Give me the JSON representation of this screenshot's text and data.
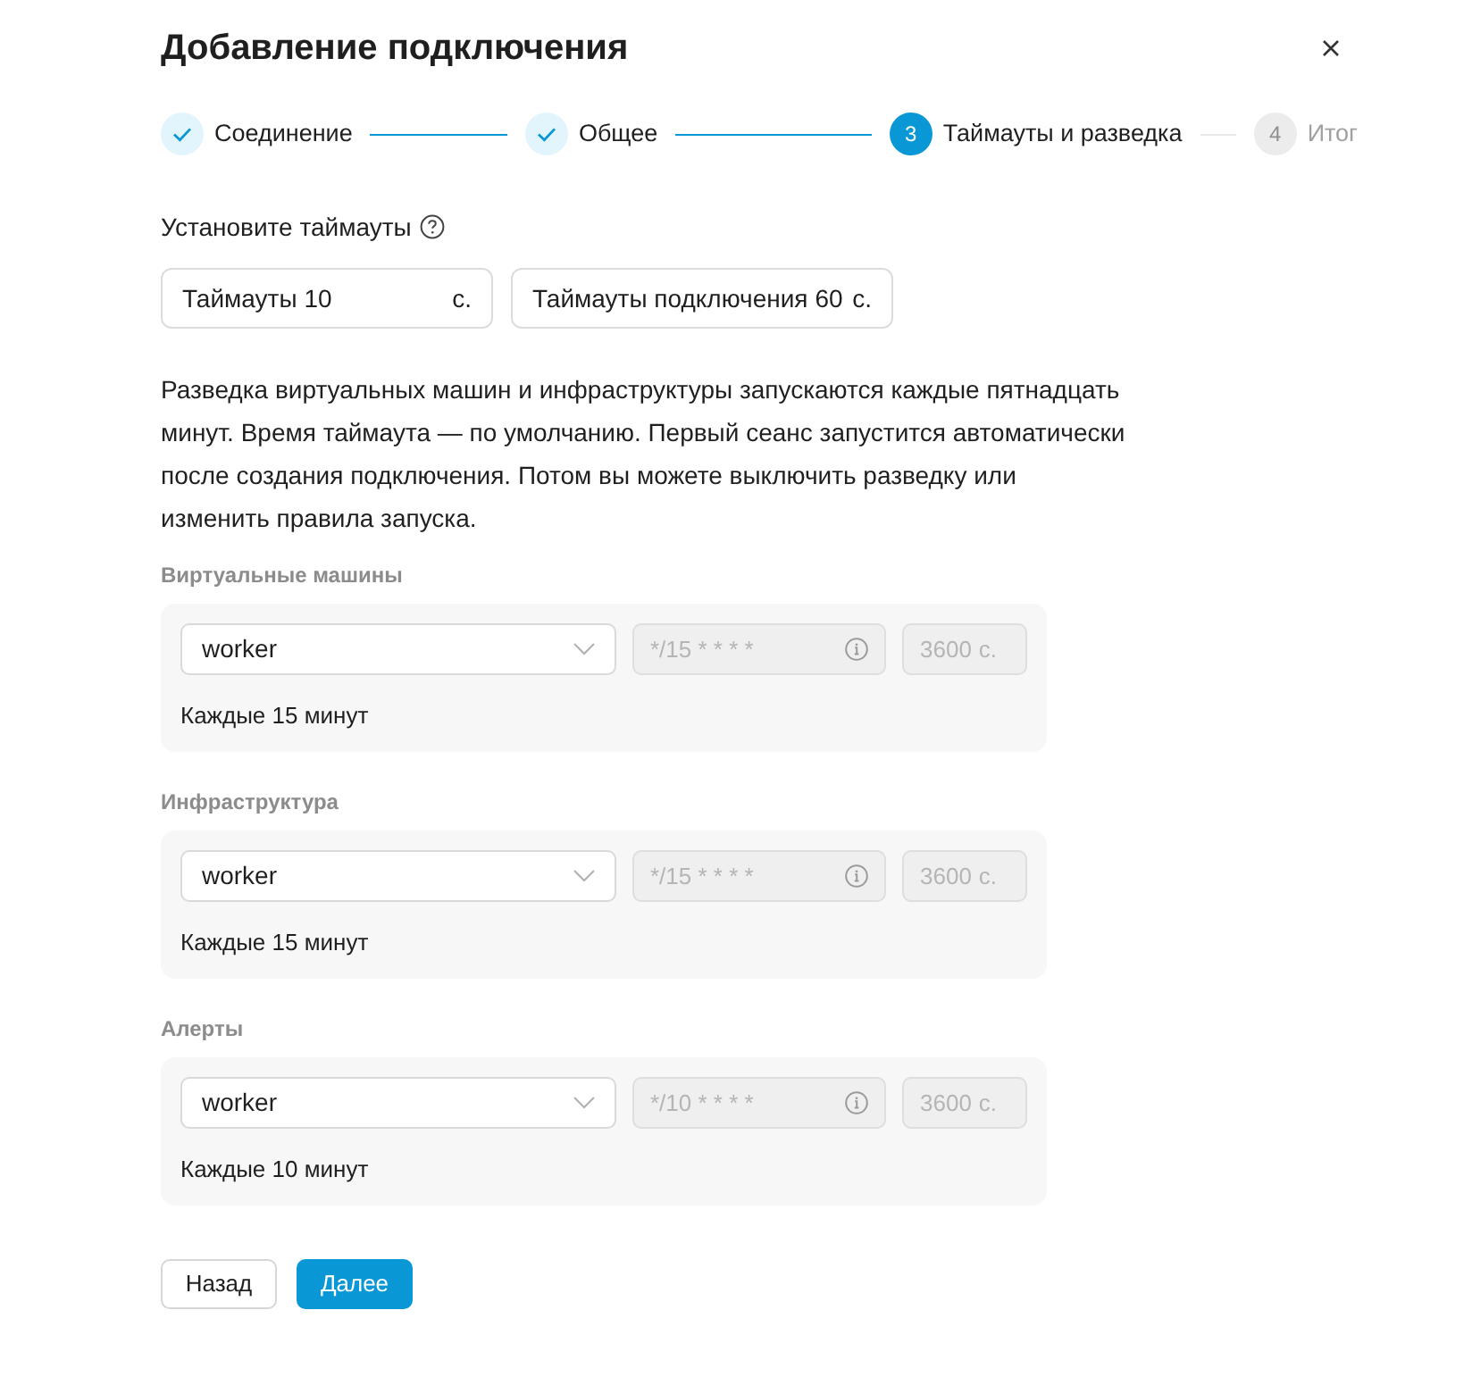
{
  "dialog": {
    "title": "Добавление подключения"
  },
  "steps": [
    {
      "label": "Соединение",
      "completed": true,
      "selected": false
    },
    {
      "label": "Общее",
      "completed": true,
      "selected": false
    },
    {
      "number": "3",
      "label": "Таймауты и разведка",
      "completed": false,
      "selected": true
    },
    {
      "number": "4",
      "label": "Итог",
      "completed": false,
      "selected": false
    }
  ],
  "timeouts": {
    "label": "Установите таймауты",
    "fields": [
      {
        "label": "Таймауты",
        "value": "10",
        "unit": "с."
      },
      {
        "label": "Таймауты подключения",
        "value": "60",
        "unit": "с."
      }
    ]
  },
  "description": "Разведка виртуальных машин и инфраструктуры запускаются каждые пятнадцать минут. Время таймаута — по умолчанию. Первый сеанс запустится автоматически после создания подключения. Потом вы можете выключить разведку или изменить правила запуска.",
  "groups": [
    {
      "title": "Виртуальные машины",
      "worker": {
        "value": "worker"
      },
      "schedule": {
        "value": "*/15 * * * *",
        "disabled": true
      },
      "duration": {
        "value": "3600",
        "unit": "с.",
        "disabled": true
      },
      "caption": "Каждые 15 минут"
    },
    {
      "title": "Инфраструктура",
      "worker": {
        "value": "worker"
      },
      "schedule": {
        "value": "*/15 * * * *",
        "disabled": true
      },
      "duration": {
        "value": "3600",
        "unit": "с.",
        "disabled": true
      },
      "caption": "Каждые 15 минут"
    },
    {
      "title": "Алерты",
      "worker": {
        "value": "worker"
      },
      "schedule": {
        "value": "*/10 * * * *",
        "disabled": true
      },
      "duration": {
        "value": "3600",
        "unit": "с.",
        "disabled": true
      },
      "caption": "Каждые 10 минут"
    }
  ],
  "buttons": [
    {
      "label": "Назад",
      "kind": "secondary"
    },
    {
      "label": "Далее",
      "kind": "primary"
    }
  ]
}
